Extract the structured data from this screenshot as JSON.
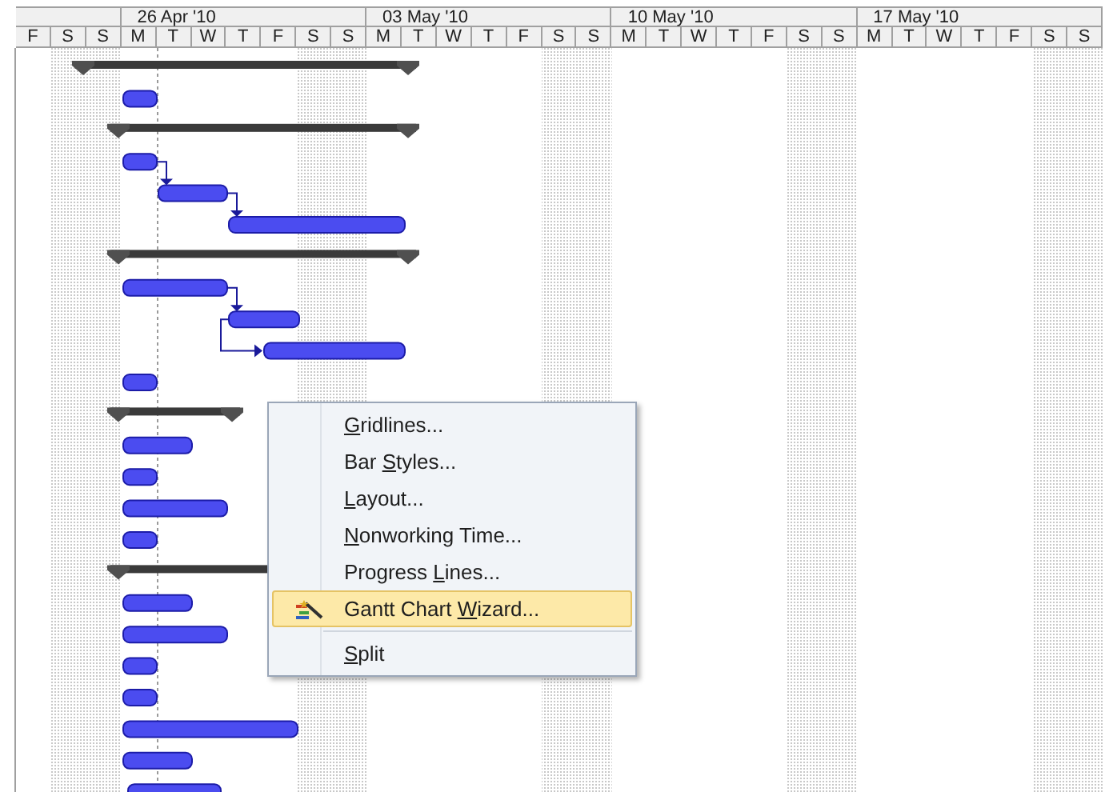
{
  "timescale": {
    "weeks": [
      {
        "label": "26 Apr '10"
      },
      {
        "label": "03 May '10"
      },
      {
        "label": "10 May '10"
      },
      {
        "label": "17 May '10"
      }
    ],
    "days": [
      {
        "label": "F",
        "weekend": false
      },
      {
        "label": "S",
        "weekend": true
      },
      {
        "label": "S",
        "weekend": true
      },
      {
        "label": "M",
        "weekend": false
      },
      {
        "label": "T",
        "weekend": false
      },
      {
        "label": "W",
        "weekend": false
      },
      {
        "label": "T",
        "weekend": false
      },
      {
        "label": "F",
        "weekend": false
      },
      {
        "label": "S",
        "weekend": true
      },
      {
        "label": "S",
        "weekend": true
      },
      {
        "label": "M",
        "weekend": false
      },
      {
        "label": "T",
        "weekend": false
      },
      {
        "label": "W",
        "weekend": false
      },
      {
        "label": "T",
        "weekend": false
      },
      {
        "label": "F",
        "weekend": false
      },
      {
        "label": "S",
        "weekend": true
      },
      {
        "label": "S",
        "weekend": true
      },
      {
        "label": "M",
        "weekend": false
      },
      {
        "label": "T",
        "weekend": false
      },
      {
        "label": "W",
        "weekend": false
      },
      {
        "label": "T",
        "weekend": false
      },
      {
        "label": "F",
        "weekend": false
      },
      {
        "label": "S",
        "weekend": true
      },
      {
        "label": "S",
        "weekend": true
      },
      {
        "label": "M",
        "weekend": false
      },
      {
        "label": "T",
        "weekend": false
      },
      {
        "label": "W",
        "weekend": false
      },
      {
        "label": "T",
        "weekend": false
      },
      {
        "label": "F",
        "weekend": false
      },
      {
        "label": "S",
        "weekend": true
      },
      {
        "label": "S",
        "weekend": true
      }
    ]
  },
  "gantt_rows": [
    {
      "kind": "summary"
    },
    {
      "kind": "task"
    },
    {
      "kind": "summary"
    },
    {
      "kind": "task"
    },
    {
      "kind": "task"
    },
    {
      "kind": "task"
    },
    {
      "kind": "summary"
    },
    {
      "kind": "task"
    },
    {
      "kind": "task"
    },
    {
      "kind": "task"
    },
    {
      "kind": "task"
    },
    {
      "kind": "summary"
    },
    {
      "kind": "task"
    },
    {
      "kind": "task"
    },
    {
      "kind": "task"
    },
    {
      "kind": "task"
    },
    {
      "kind": "summary"
    },
    {
      "kind": "task"
    },
    {
      "kind": "task"
    },
    {
      "kind": "task"
    },
    {
      "kind": "task"
    },
    {
      "kind": "task"
    },
    {
      "kind": "task"
    },
    {
      "kind": "task"
    }
  ],
  "context_menu": {
    "items": [
      {
        "mnemonic": "G",
        "label_end": "ridlines...",
        "selected": false
      },
      {
        "label_start": "Bar ",
        "mnemonic": "S",
        "label_end": "tyles...",
        "selected": false
      },
      {
        "mnemonic": "L",
        "label_end": "ayout...",
        "selected": false
      },
      {
        "mnemonic": "N",
        "label_end": "onworking Time...",
        "selected": false
      },
      {
        "label_start": "Progress ",
        "mnemonic": "L",
        "label_end": "ines...",
        "selected": false
      },
      {
        "label_start": "Gantt Chart ",
        "mnemonic": "W",
        "label_end": "izard...",
        "selected": true,
        "icon": true
      },
      {
        "mnemonic": "S",
        "label_end": "plit",
        "selected": false,
        "separator_before": true
      }
    ]
  }
}
